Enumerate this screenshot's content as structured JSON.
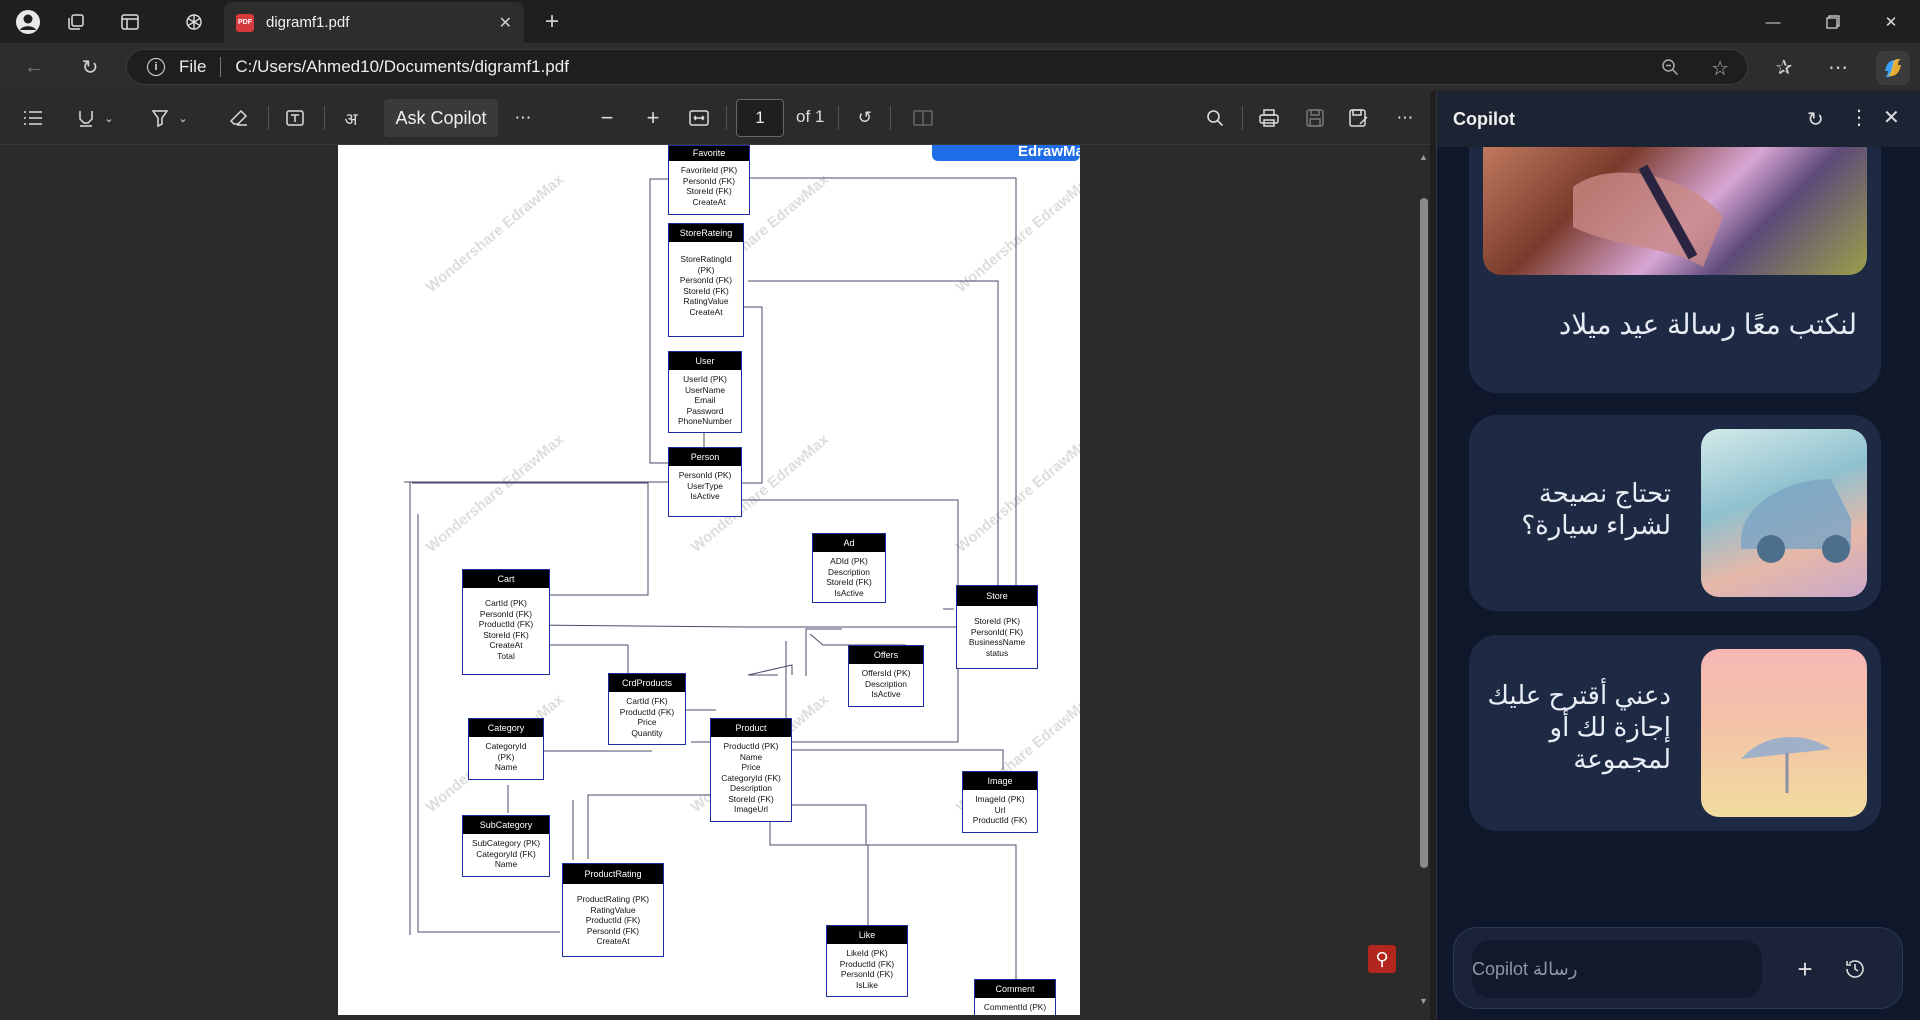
{
  "browser": {
    "tab_title": "digramf1.pdf",
    "url_scheme_label": "File",
    "url": "C:/Users/Ahmed10/Documents/digramf1.pdf"
  },
  "pdf_toolbar": {
    "ask_copilot": "Ask Copilot",
    "page_current": "1",
    "page_total": "of 1"
  },
  "diagram": {
    "brand": "EdrawMax",
    "watermark": "Wondershare EdrawMax",
    "entities": [
      {
        "title": "Favorite",
        "fields": [
          "FavoriteId (PK)",
          "PersonId (FK)",
          "StoreId (FK)",
          "CreateAt"
        ]
      },
      {
        "title": "StoreRateing",
        "fields": [
          "StoreRatingId",
          "(PK)",
          "PersonId (FK)",
          "StoreId (FK)",
          "RatingValue",
          "CreateAt"
        ]
      },
      {
        "title": "User",
        "fields": [
          "UserId (PK)",
          "UserName",
          "Email",
          "Password",
          "PhoneNumber"
        ]
      },
      {
        "title": "Person",
        "fields": [
          "PersonId (PK)",
          "UserType",
          "IsActive"
        ]
      },
      {
        "title": "Ad",
        "fields": [
          "ADId (PK)",
          "Description",
          "StoreId (FK)",
          "IsActive"
        ]
      },
      {
        "title": "Cart",
        "fields": [
          "CartId (PK)",
          "PersonId (FK)",
          "ProductId (FK)",
          "StoreId (FK)",
          "CreateAt",
          "Total"
        ]
      },
      {
        "title": "Store",
        "fields": [
          "StoreId (PK)",
          "PersonId( FK)",
          "BusinessName",
          "status"
        ]
      },
      {
        "title": "Offers",
        "fields": [
          "OffersId (PK)",
          "Description",
          "IsActive"
        ]
      },
      {
        "title": "CrdProducts",
        "fields": [
          "CartId (FK)",
          "ProductId (FK)",
          "Price",
          "Quantity"
        ]
      },
      {
        "title": "Category",
        "fields": [
          "CategoryId",
          "(PK)",
          "Name"
        ]
      },
      {
        "title": "Product",
        "fields": [
          "ProductId (PK)",
          "Name",
          "Price",
          "CategoryId (FK)",
          "Description",
          "StoreId (FK)",
          "ImageUrl"
        ]
      },
      {
        "title": "Image",
        "fields": [
          "ImageId (PK)",
          "Url",
          "ProductId (FK)"
        ]
      },
      {
        "title": "SubCategory",
        "fields": [
          "SubCategory (PK)",
          "CategoryId (FK)",
          "Name"
        ]
      },
      {
        "title": "ProductRating",
        "fields": [
          "ProductRating (PK)",
          "RatingValue",
          "ProductId (FK)",
          "PersonId (FK)",
          "CreateAt"
        ]
      },
      {
        "title": "Like",
        "fields": [
          "LikeId (PK)",
          "ProductId (FK)",
          "PersonId (FK)",
          "IsLike"
        ]
      },
      {
        "title": "Comment",
        "fields": [
          "CommentId (PK)"
        ]
      }
    ]
  },
  "copilot": {
    "title": "Copilot",
    "cards": [
      {
        "text": "لنكتب معًا رسالة عيد ميلاد"
      },
      {
        "text": "تحتاج نصيحة لشراء سيارة؟"
      },
      {
        "text": "دعني أقترح عليك إجازة لك أو لمجموعة"
      }
    ],
    "input_placeholder": "رسالة Copilot"
  }
}
